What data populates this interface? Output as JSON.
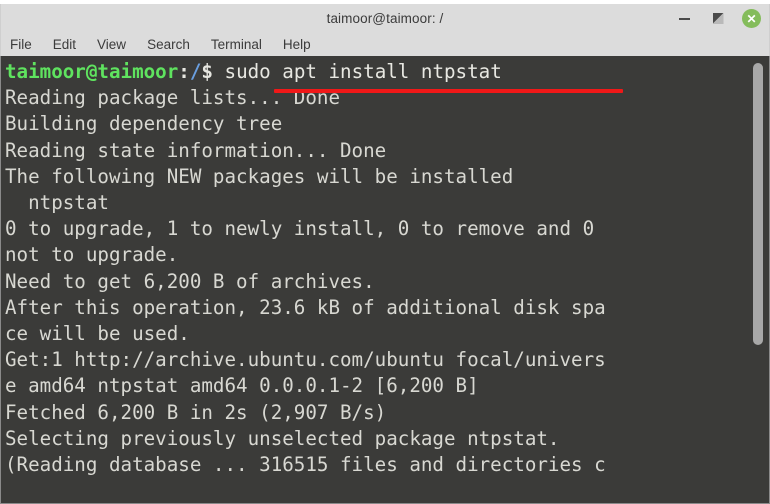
{
  "window": {
    "title": "taimoor@taimoor: /",
    "controls": {
      "minimize_label": "–",
      "maximize_label": "",
      "close_label": "✕"
    }
  },
  "menubar": {
    "items": [
      {
        "label": "File"
      },
      {
        "label": "Edit"
      },
      {
        "label": "View"
      },
      {
        "label": "Search"
      },
      {
        "label": "Terminal"
      },
      {
        "label": "Help"
      }
    ]
  },
  "terminal": {
    "prompt": {
      "user_host": "taimoor@taimoor",
      "colon": ":",
      "path": "/",
      "sigil": "$ ",
      "command": "sudo apt install ntpstat"
    },
    "output_lines": [
      "Reading package lists... Done",
      "Building dependency tree",
      "Reading state information... Done",
      "The following NEW packages will be installed",
      "  ntpstat",
      "0 to upgrade, 1 to newly install, 0 to remove and 0",
      "not to upgrade.",
      "Need to get 6,200 B of archives.",
      "After this operation, 23.6 kB of additional disk spa",
      "ce will be used.",
      "Get:1 http://archive.ubuntu.com/ubuntu focal/univers",
      "e amd64 ntpstat amd64 0.0.0.1-2 [6,200 B]",
      "Fetched 6,200 B in 2s (2,907 B/s)",
      "Selecting previously unselected package ntpstat.",
      "(Reading database ... 316515 files and directories c"
    ],
    "colors": {
      "background": "#3b3b39",
      "foreground": "#d8d8d2",
      "prompt_user": "#5fe35f",
      "prompt_path": "#6a9fe0",
      "annotation": "#f01818"
    }
  },
  "scrollbar": {
    "orientation": "vertical"
  }
}
